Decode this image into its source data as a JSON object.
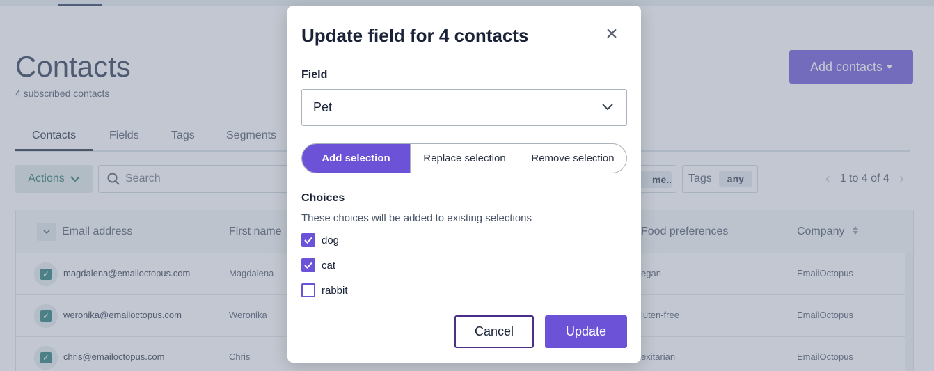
{
  "page": {
    "title": "Contacts",
    "subtitle": "4 subscribed contacts",
    "add_contacts_label": "Add contacts"
  },
  "tabs": [
    {
      "label": "Contacts",
      "active": true
    },
    {
      "label": "Fields"
    },
    {
      "label": "Tags"
    },
    {
      "label": "Segments"
    }
  ],
  "toolbar": {
    "actions_label": "Actions",
    "search_placeholder": "Search",
    "filter_chip_text": "me...",
    "tags_label": "Tags",
    "tags_value": "any",
    "pagination": "1 to 4 of 4"
  },
  "table": {
    "columns": [
      "Email address",
      "First name",
      "Food preferences",
      "Company"
    ],
    "rows": [
      {
        "email": "magdalena@emailoctopus.com",
        "first_name": "Magdalena",
        "food": "egan",
        "company": "EmailOctopus"
      },
      {
        "email": "weronika@emailoctopus.com",
        "first_name": "Weronika",
        "food": "luten-free",
        "company": "EmailOctopus"
      },
      {
        "email": "chris@emailoctopus.com",
        "first_name": "Chris",
        "food": "exitarian",
        "company": "EmailOctopus"
      }
    ]
  },
  "modal": {
    "title": "Update field for 4 contacts",
    "field_label": "Field",
    "field_value": "Pet",
    "modes": [
      "Add selection",
      "Replace selection",
      "Remove selection"
    ],
    "active_mode": "Add selection",
    "choices_label": "Choices",
    "choices_hint": "These choices will be added to existing selections",
    "choices": [
      {
        "label": "dog",
        "checked": true
      },
      {
        "label": "cat",
        "checked": true
      },
      {
        "label": "rabbit",
        "checked": false
      }
    ],
    "cancel_label": "Cancel",
    "update_label": "Update"
  },
  "colors": {
    "accent": "#6b52d6",
    "teal": "#1d7a72",
    "overlay": "rgba(125,136,158,0.47)"
  }
}
